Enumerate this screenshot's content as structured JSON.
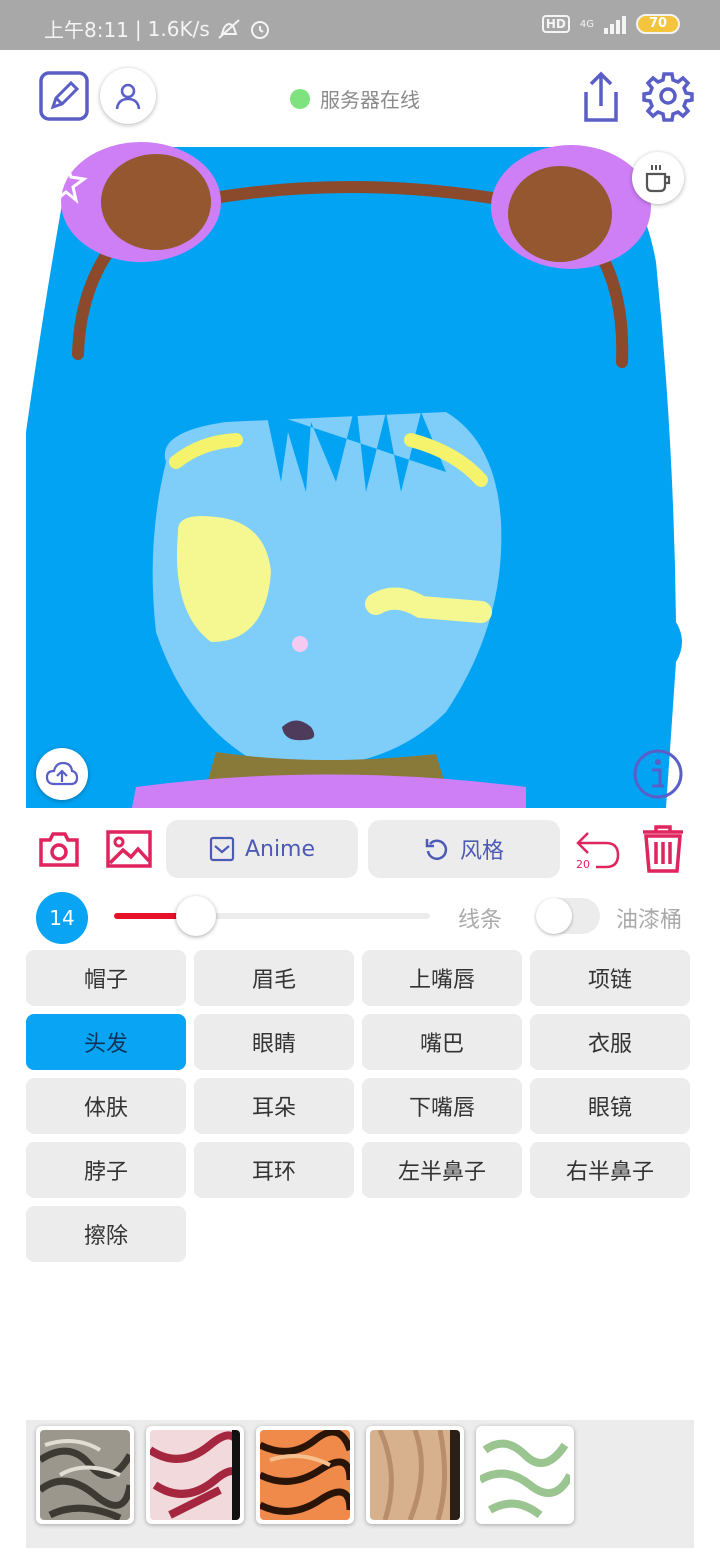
{
  "status_bar": {
    "time": "上午8:11",
    "net_speed": "1.6K/s",
    "hd_label": "HD",
    "network_type": "4G",
    "battery": "70"
  },
  "header": {
    "server_status": "服务器在线"
  },
  "toolbar": {
    "anime_label": "Anime",
    "style_label": "风格",
    "undo_count": "20"
  },
  "brush": {
    "size": "14",
    "size_fraction": 0.26,
    "line_label": "线条",
    "bucket_label": "油漆桶",
    "bucket_enabled": false
  },
  "parts": [
    {
      "label": "帽子",
      "active": false
    },
    {
      "label": "眉毛",
      "active": false
    },
    {
      "label": "上嘴唇",
      "active": false
    },
    {
      "label": "项链",
      "active": false
    },
    {
      "label": "头发",
      "active": true
    },
    {
      "label": "眼睛",
      "active": false
    },
    {
      "label": "嘴巴",
      "active": false
    },
    {
      "label": "衣服",
      "active": false
    },
    {
      "label": "体肤",
      "active": false
    },
    {
      "label": "耳朵",
      "active": false
    },
    {
      "label": "下嘴唇",
      "active": false
    },
    {
      "label": "眼镜",
      "active": false
    },
    {
      "label": "脖子",
      "active": false
    },
    {
      "label": "耳环",
      "active": false
    },
    {
      "label": "左半鼻子",
      "active": false
    },
    {
      "label": "右半鼻子",
      "active": false
    },
    {
      "label": "擦除",
      "active": false
    }
  ],
  "colors": {
    "accent_blue": "#0aa4f4",
    "accent_red": "#e8112a",
    "icon_purple": "#5a5fc8",
    "icon_pink": "#e0245e"
  },
  "textures": [
    "texture-gray",
    "texture-red",
    "texture-orange",
    "texture-beige",
    "texture-green"
  ]
}
